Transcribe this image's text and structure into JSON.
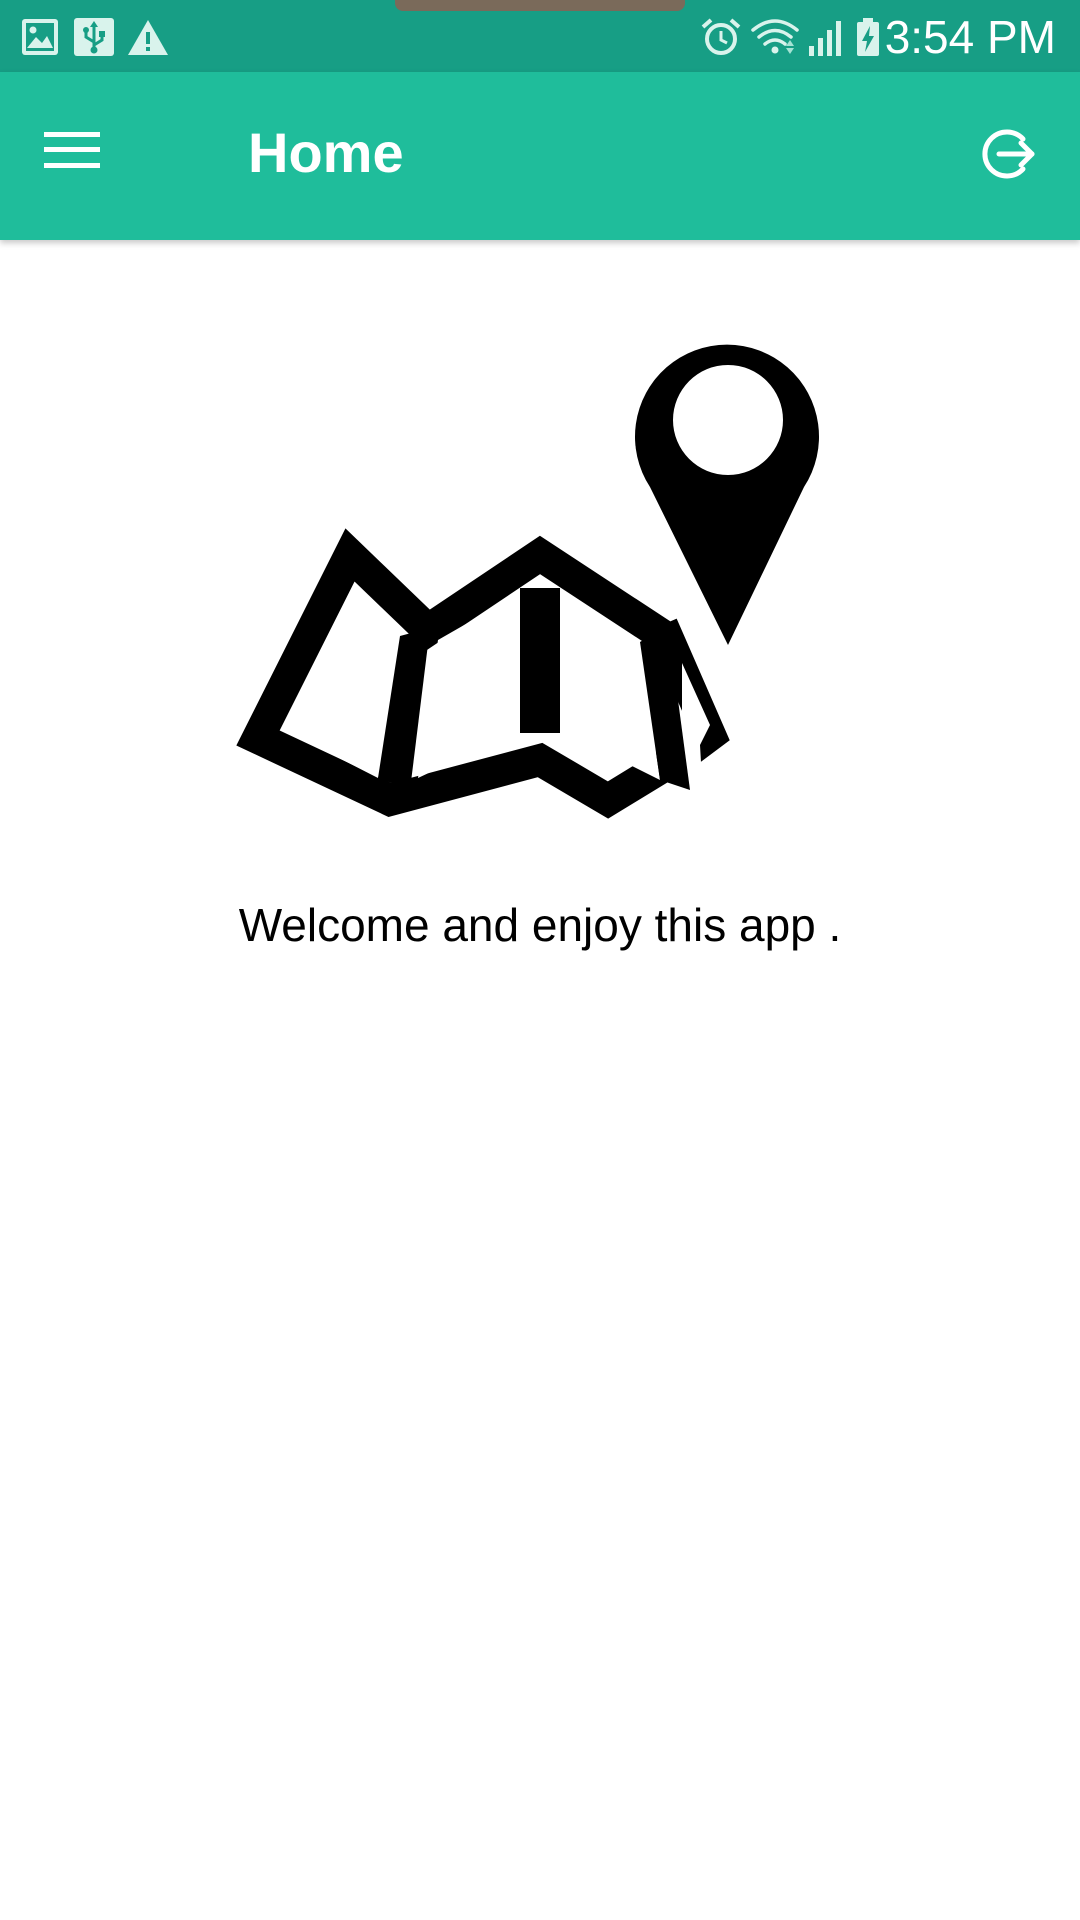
{
  "status_bar": {
    "time": "3:54 PM",
    "icons_left": [
      "image-icon",
      "usb-icon",
      "warning-icon"
    ],
    "icons_right": [
      "alarm-icon",
      "wifi-icon",
      "signal-icon",
      "battery-charging-icon"
    ]
  },
  "app_bar": {
    "title": "Home",
    "menu_icon": "hamburger-menu-icon",
    "logout_icon": "logout-icon"
  },
  "content": {
    "illustration": "map-with-location-pin",
    "welcome_text": "Welcome and enjoy this app ."
  },
  "colors": {
    "status_bar": "#179e85",
    "app_bar": "#1fbd9b",
    "background": "#ffffff",
    "text": "#000000"
  }
}
